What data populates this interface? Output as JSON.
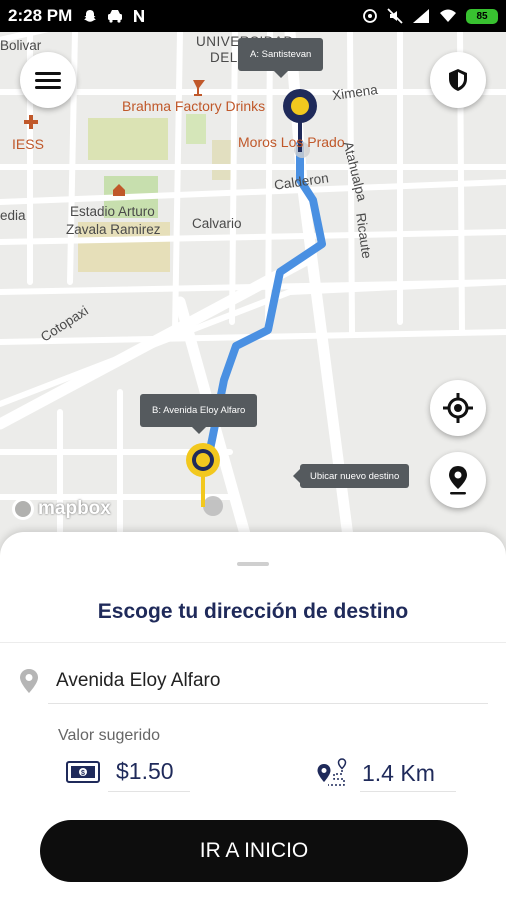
{
  "status_bar": {
    "time": "2:28 PM",
    "battery": "85",
    "left_icons": [
      "snapchat-icon",
      "car-icon",
      "n-icon"
    ],
    "right_icons": [
      "hotspot-icon",
      "mute-icon",
      "signal-icon",
      "wifi-icon",
      "battery-icon"
    ]
  },
  "map": {
    "labels": {
      "bolivar": "Bolivar",
      "universidad": "UNIVERSIDAD",
      "universidad2": "DEL",
      "ximena": "Ximena",
      "brahma": "Brahma Factory Drinks",
      "iess": "IESS",
      "moros": "Moros Los Prado",
      "atahualpa": "Atahualpa",
      "calderon": "Calderon",
      "estadio": "Estadio Arturo",
      "estadio2": "Zavala Ramirez",
      "calvario": "Calvario",
      "ricaute": "Ricaute",
      "media": "edia",
      "cotopaxi": "Cotopaxi"
    },
    "tooltip_origin": "A: Santistevan",
    "tooltip_destination": "B: Avenida Eloy Alfaro",
    "tooltip_new_destination": "Ubicar nuevo destino",
    "attribution": "mapbox",
    "route_color": "#4a90e2",
    "pin_color": "#f2c81e",
    "pin_ring_color": "#1f2a5a"
  },
  "controls": {
    "menu_icon": "hamburger-menu-icon",
    "shield_icon": "shield-icon",
    "locate_icon": "crosshair-icon",
    "new_destination_icon": "map-pin-icon"
  },
  "sheet": {
    "title": "Escoge tu dirección de destino",
    "destination": "Avenida Eloy Alfaro",
    "suggested_label": "Valor sugerido",
    "price": "$1.50",
    "distance": "1.4 Km",
    "cta": "IR A INICIO"
  },
  "colors": {
    "brand_navy": "#1f2a5a",
    "cta_background": "#0d0d0d"
  }
}
